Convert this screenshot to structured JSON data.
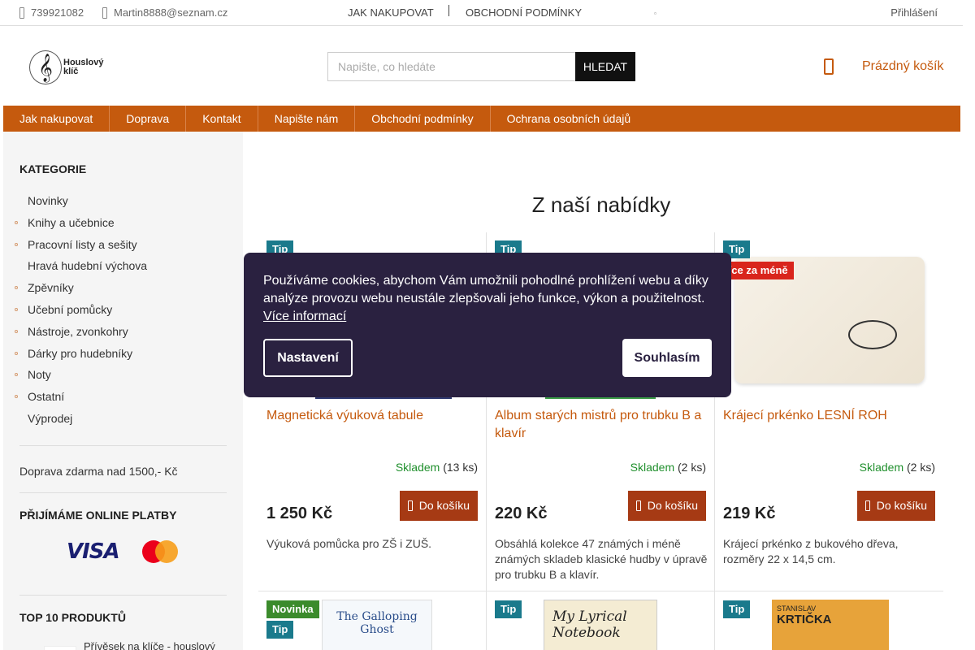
{
  "topbar": {
    "phone": "739921082",
    "email": "Martin8888@seznam.cz",
    "link_howto": "JAK NAKUPOVAT",
    "link_terms": "OBCHODNÍ PODMÍNKY",
    "login": "Přihlášení"
  },
  "header": {
    "logo_text": "Houslový klíč",
    "search_placeholder": "Napište, co hledáte",
    "search_button": "HLEDAT",
    "cart": "Prázdný košík"
  },
  "nav": [
    "Jak nakupovat",
    "Doprava",
    "Kontakt",
    "Napište nám",
    "Obchodní podmínky",
    "Ochrana osobních údajů"
  ],
  "sidebar": {
    "categories_title": "KATEGORIE",
    "categories": [
      {
        "label": "Novinky",
        "dot": false
      },
      {
        "label": "Knihy a učebnice",
        "dot": true
      },
      {
        "label": "Pracovní listy a sešity",
        "dot": true
      },
      {
        "label": "Hravá hudební výchova",
        "dot": false
      },
      {
        "label": "Zpěvníky",
        "dot": true
      },
      {
        "label": "Učební pomůcky",
        "dot": true
      },
      {
        "label": "Nástroje, zvonkohry",
        "dot": true
      },
      {
        "label": "Dárky pro hudebníky",
        "dot": true
      },
      {
        "label": "Noty",
        "dot": true
      },
      {
        "label": "Ostatní",
        "dot": true
      },
      {
        "label": "Výprodej",
        "dot": false
      }
    ],
    "shipping": "Doprava zdarma nad 1500,- Kč",
    "payments_title": "PŘIJÍMÁME ONLINE PLATBY",
    "visa": "VISA",
    "top_title": "TOP 10 PRODUKTŮ",
    "top_item": "Přívěsek na klíče - houslový"
  },
  "main": {
    "title": "Z naší nabídky",
    "products": [
      {
        "badges": [
          "Tip"
        ],
        "name": "Magnetická výuková tabule",
        "stock_label": "Skladem",
        "stock_count": "(13 ks)",
        "price": "1 250 Kč",
        "buy": "Do košíku",
        "desc": "Výuková pomůcka pro ZŠ i ZUŠ."
      },
      {
        "badges": [
          "Tip"
        ],
        "name": "Album starých mistrů pro trubku B a klavír",
        "stock_label": "Skladem",
        "stock_count": "(2 ks)",
        "price": "220 Kč",
        "buy": "Do košíku",
        "desc": "Obsáhlá kolekce 47 známých i méně známých skladeb klasické hudby v úpravě pro trubku B a klavír."
      },
      {
        "badges": [
          "Tip",
          "Více za méně"
        ],
        "name": "Krájecí prkénko LESNÍ ROH",
        "stock_label": "Skladem",
        "stock_count": "(2 ks)",
        "price": "219 Kč",
        "buy": "Do košíku",
        "desc": "Krájecí prkénko z bukového dřeva, rozměry 22 x 14,5 cm."
      }
    ],
    "row2": [
      {
        "badges": [
          "Novinka",
          "Tip"
        ],
        "cover_title": "The Galloping Ghost"
      },
      {
        "badges": [
          "Tip"
        ],
        "cover_title": "My Lyrical Notebook"
      },
      {
        "badges": [
          "Tip"
        ],
        "cover_author": "STANISLAV",
        "cover_title": "KRTIČKA"
      }
    ]
  },
  "cookie": {
    "message": "Používáme cookies, abychom Vám umožnili pohodlné prohlížení webu a díky analýze provozu webu neustále zlepšovali jeho funkce, výkon a použitelnost.",
    "more": "Více informací",
    "settings": "Nastavení",
    "accept": "Souhlasím"
  },
  "colors": {
    "accent": "#c55a0e",
    "buy": "#a63a14",
    "tip": "#1a7a8c",
    "new": "#3b8b2c",
    "less": "#d9251c",
    "cookie_bg": "#2a2140"
  }
}
